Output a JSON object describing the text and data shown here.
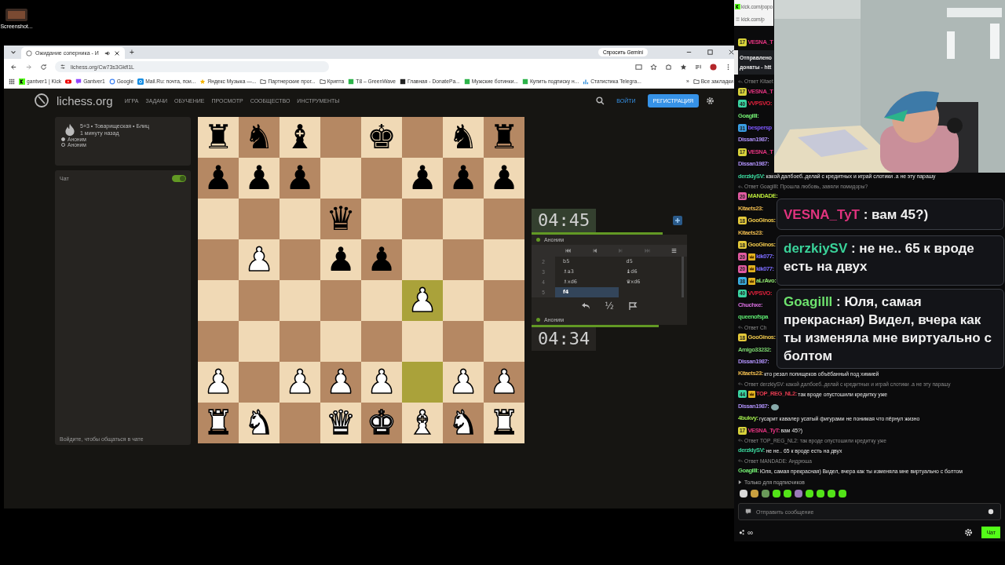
{
  "desktop": {
    "icon_label": "Screenshot..."
  },
  "browser": {
    "tab": {
      "title": "Ожидание соперника - И",
      "audio": true
    },
    "new_tab": "+",
    "gemini_button": "Спросить Gemini",
    "address": "lichess.org/Cw73s3Gkfl1L",
    "bookmarks": [
      {
        "kind": "kick",
        "label": "gantver1 | Kick"
      },
      {
        "kind": "youtube"
      },
      {
        "kind": "twitch",
        "label": "Gantver1"
      },
      {
        "kind": "google",
        "label": "Google"
      },
      {
        "kind": "mail",
        "label": "Mail.Ru: почта, пои..."
      },
      {
        "kind": "star",
        "label": "Яндекс Музыка —..."
      },
      {
        "kind": "folder",
        "label": "Партнерские прог..."
      },
      {
        "kind": "folder",
        "label": "Крипта"
      },
      {
        "kind": "green",
        "label": "T8 – GreenWave"
      },
      {
        "kind": "dark",
        "label": "Главная - DonatePa..."
      },
      {
        "kind": "green",
        "label": "Мужские ботинки..."
      },
      {
        "kind": "green",
        "label": "Купить подписку н..."
      },
      {
        "kind": "chart",
        "label": "Статистика Telegra..."
      }
    ],
    "more_bookmarks": "»",
    "all_bookmarks": "Все закладки"
  },
  "lichess": {
    "logo": "lichess.org",
    "nav": [
      "ИГРА",
      "ЗАДАЧИ",
      "ОБУЧЕНИЕ",
      "ПРОСМОТР",
      "СООБЩЕСТВО",
      "ИНСТРУМЕНТЫ"
    ],
    "login": "ВОЙТИ",
    "signup": "РЕГИСТРАЦИЯ"
  },
  "game": {
    "title": "5+3 • Товарищеская • Блиц",
    "time": "1 минуту назад",
    "players": [
      {
        "name": "Аноним",
        "white": true
      },
      {
        "name": "Аноним",
        "white": false
      }
    ]
  },
  "chat_panel": {
    "title": "Чат",
    "on": true,
    "footer": "Войдите, чтобы общаться в чате"
  },
  "board": {
    "ranks": [
      [
        {
          "piece": "♜",
          "white": false,
          "highlighted": false
        },
        {
          "piece": "♞",
          "white": false,
          "highlighted": false
        },
        {
          "piece": "♝",
          "white": false,
          "highlighted": false
        },
        {
          "highlighted": false
        },
        {
          "piece": "♚",
          "white": false,
          "highlighted": false
        },
        {
          "highlighted": false
        },
        {
          "piece": "♞",
          "white": false,
          "highlighted": false
        },
        {
          "piece": "♜",
          "white": false,
          "highlighted": false
        }
      ],
      [
        {
          "piece": "♟",
          "white": false,
          "highlighted": false
        },
        {
          "piece": "♟",
          "white": false,
          "highlighted": false
        },
        {
          "piece": "♟",
          "white": false,
          "highlighted": false
        },
        {
          "highlighted": false
        },
        {
          "highlighted": false
        },
        {
          "piece": "♟",
          "white": false,
          "highlighted": false
        },
        {
          "piece": "♟",
          "white": false,
          "highlighted": false
        },
        {
          "piece": "♟",
          "white": false,
          "highlighted": false
        }
      ],
      [
        {
          "highlighted": false
        },
        {
          "highlighted": false
        },
        {
          "highlighted": false
        },
        {
          "piece": "♛",
          "white": false,
          "highlighted": false
        },
        {
          "highlighted": false
        },
        {
          "highlighted": false
        },
        {
          "highlighted": false
        },
        {
          "highlighted": false
        }
      ],
      [
        {
          "highlighted": false
        },
        {
          "piece": "♟",
          "white": true,
          "highlighted": false
        },
        {
          "highlighted": false
        },
        {
          "piece": "♟",
          "white": false,
          "highlighted": false
        },
        {
          "piece": "♟",
          "white": false,
          "highlighted": false
        },
        {
          "highlighted": false
        },
        {
          "highlighted": false
        },
        {
          "highlighted": false
        }
      ],
      [
        {
          "highlighted": false
        },
        {
          "highlighted": false
        },
        {
          "highlighted": false
        },
        {
          "highlighted": false
        },
        {
          "highlighted": false
        },
        {
          "piece": "♟",
          "white": true,
          "highlighted": true
        },
        {
          "highlighted": false
        },
        {
          "highlighted": false
        }
      ],
      [
        {
          "highlighted": false
        },
        {
          "highlighted": false
        },
        {
          "highlighted": false
        },
        {
          "highlighted": false
        },
        {
          "highlighted": false
        },
        {
          "highlighted": false
        },
        {
          "highlighted": false
        },
        {
          "highlighted": false
        }
      ],
      [
        {
          "piece": "♟",
          "white": true,
          "highlighted": false
        },
        {
          "highlighted": false
        },
        {
          "piece": "♟",
          "white": true,
          "highlighted": false
        },
        {
          "piece": "♟",
          "white": true,
          "highlighted": false
        },
        {
          "piece": "♟",
          "white": true,
          "highlighted": false
        },
        {
          "highlighted": true
        },
        {
          "piece": "♟",
          "white": true,
          "highlighted": false
        },
        {
          "piece": "♟",
          "white": true,
          "highlighted": false
        }
      ],
      [
        {
          "piece": "♜",
          "white": true,
          "highlighted": false
        },
        {
          "piece": "♞",
          "white": true,
          "highlighted": false
        },
        {
          "highlighted": false
        },
        {
          "piece": "♛",
          "white": true,
          "highlighted": false
        },
        {
          "piece": "♚",
          "white": true,
          "highlighted": false
        },
        {
          "piece": "♝",
          "white": true,
          "highlighted": false
        },
        {
          "piece": "♞",
          "white": true,
          "highlighted": false
        },
        {
          "piece": "♜",
          "white": true,
          "highlighted": false
        }
      ]
    ]
  },
  "clocks": {
    "top": {
      "time": "04:45",
      "player": "Аноним",
      "online": true,
      "level": 0.93
    },
    "bottom": {
      "time": "04:34",
      "player": "Аноним",
      "online": true,
      "level": 0.9
    }
  },
  "moves": [
    {
      "number": "2",
      "white": {
        "san": "b5",
        "selected": false
      },
      "black": {
        "san": "d5",
        "selected": false
      }
    },
    {
      "number": "3",
      "white": {
        "san": "♗a3",
        "selected": false
      },
      "black": {
        "san": "♝d6",
        "selected": false
      }
    },
    {
      "number": "4",
      "white": {
        "san": "♗xd6",
        "selected": false
      },
      "black": {
        "san": "♛xd6",
        "selected": false
      }
    },
    {
      "number": "5",
      "white": {
        "san": "f4",
        "selected": true
      }
    }
  ],
  "draw_offer": "½",
  "stream": {
    "kick_tabs": [
      "kick.com/popo",
      "kick.com/p"
    ],
    "messages": [
      {
        "kind": "message",
        "badge": {
          "text": "17",
          "color": "#d8d23a"
        },
        "user": "VESNA_T",
        "color": "#e0337e"
      },
      {
        "kind": "pinned",
        "lines": [
          "Отправлено",
          "донаты - htt"
        ]
      },
      {
        "kind": "reply",
        "text": "Ответ Kitaet"
      },
      {
        "kind": "message",
        "badge": {
          "text": "17",
          "color": "#d8d23a"
        },
        "user": "VESNA_T",
        "color": "#e0337e"
      },
      {
        "kind": "message",
        "badge": {
          "text": "40",
          "color": "#3ad3a0"
        },
        "user": "VVPSVO:",
        "color": "#e0213c"
      },
      {
        "kind": "message",
        "user": "Goagilll:",
        "color": "#6ee36e"
      },
      {
        "kind": "message",
        "badge": {
          "text": "31",
          "color": "#3a9ee3"
        },
        "user": "bespersp",
        "color": "#7a55f5"
      },
      {
        "kind": "message",
        "user": "Dissan1987:",
        "color": "#a98cf0"
      },
      {
        "kind": "message",
        "badge": {
          "text": "17",
          "color": "#d8d23a"
        },
        "user": "VESNA_T",
        "color": "#e0337e"
      },
      {
        "kind": "message",
        "user": "Dissan1987:",
        "color": "#a98cf0"
      },
      {
        "kind": "message",
        "user": "derzkiySV:",
        "color": "#3ad39a",
        "text": "какой далбоеб..делай с кредитных и играй слотики .а не эту парашу"
      },
      {
        "kind": "reply",
        "text": "Ответ Goagilll: Прошла любовь, завяли помидоры?"
      },
      {
        "kind": "message",
        "badge": {
          "text": "20",
          "color": "#e05aa0"
        },
        "user": "MANDADE:",
        "color": "#b6e33a"
      },
      {
        "kind": "message",
        "user": "Kitaets23:",
        "color": "#e8b64c"
      },
      {
        "kind": "message",
        "badge": {
          "text": "18",
          "color": "#e3c83a"
        },
        "user": "GooGinos:",
        "color": "#e8c24a"
      },
      {
        "kind": "message",
        "user": "Kitaets23:",
        "color": "#e8b64c"
      },
      {
        "kind": "message",
        "badge": {
          "text": "18",
          "color": "#e3c83a"
        },
        "user": "GooGinos:",
        "color": "#e8c24a"
      },
      {
        "kind": "message",
        "badge": {
          "text": "20",
          "color": "#e05aa0"
        },
        "crown": true,
        "user": "kik077:",
        "color": "#7c6cff"
      },
      {
        "kind": "message",
        "badge": {
          "text": "20",
          "color": "#e05aa0"
        },
        "crown": true,
        "user": "kik077:",
        "color": "#7c6cff"
      },
      {
        "kind": "message",
        "badge": {
          "text": "38",
          "color": "#3ab0e3"
        },
        "crown": true,
        "user": "aLrAvo:",
        "color": "#8ee36e"
      },
      {
        "kind": "message",
        "badge": {
          "text": "40",
          "color": "#3ad3a0"
        },
        "user": "VVPSVO:",
        "color": "#e0213c"
      },
      {
        "kind": "message",
        "user": "Chuchxe:",
        "color": "#d86fe0"
      },
      {
        "kind": "message",
        "user": "queenofspa",
        "color": "#5be36e"
      },
      {
        "kind": "reply",
        "text": "Ответ Ch"
      },
      {
        "kind": "message",
        "badge": {
          "text": "18",
          "color": "#e3c83a"
        },
        "user": "GooGinos:",
        "color": "#e8c24a"
      },
      {
        "kind": "message",
        "user": "Amigo33232:",
        "color": "#7ad36e"
      },
      {
        "kind": "message",
        "user": "Dissan1987:",
        "color": "#a98cf0"
      },
      {
        "kind": "message",
        "user": "Kitaets23:",
        "color": "#e8b64c",
        "text": "кто резал попищеков объёбанный под химией"
      },
      {
        "kind": "reply",
        "text": "Ответ derzkiySV: какой далбоеб..делай с кредитных и играй слотики .а не эту парашу"
      },
      {
        "kind": "message",
        "badge": {
          "text": "44",
          "color": "#3ad3a0"
        },
        "crown": true,
        "user": "TOP_REG_NL2:",
        "color": "#e03a4e",
        "text": "так вроде опустошили кредитку уже"
      },
      {
        "kind": "message",
        "user": "Dissan1987:",
        "color": "#a98cf0",
        "emote": true
      },
      {
        "kind": "message",
        "user": "4bukvy:",
        "color": "#9be34a",
        "text": "гусарит кавалер усатый фигурами не понимая что пёрнул жизно"
      },
      {
        "kind": "message",
        "badge": {
          "text": "17",
          "color": "#d8d23a"
        },
        "user": "VESNA_TyT:",
        "color": "#e0337e",
        "text": "вам 45?)"
      },
      {
        "kind": "reply",
        "text": "Ответ TOP_REG_NL2: так вроде опустошили кредитку уже"
      },
      {
        "kind": "message",
        "user": "derzkiySV:",
        "color": "#3ad39a",
        "text": "не не.. 65 к вроде есть на двух"
      },
      {
        "kind": "reply",
        "text": "Ответ MANDADE: Андрюша"
      },
      {
        "kind": "message",
        "user": "Goagilll:",
        "color": "#6ee36e",
        "text": "Юля, самая прекрасная) Видел, вчера как ты изменяла мне виртуально с болтом"
      }
    ],
    "overlays": [
      {
        "user": "VESNA_TyT",
        "color": "#e0337e",
        "text": ": вам 45?)"
      },
      {
        "user": "derzkiySV",
        "color": "#3ad39a",
        "text": ": не не.. 65 к вроде есть на двух"
      },
      {
        "user": "Goagilll",
        "color": "#6ee36e",
        "text": ": Юля, самая прекрасная) Видел, вчера как ты изменяла мне виртуально с болтом"
      }
    ],
    "subscribers_only": "Только для подписчиков",
    "emotes": [
      {
        "color": "#d9d9d9"
      },
      {
        "color": "#c9a040"
      },
      {
        "color": "#6a9a5a"
      },
      {
        "color": "#53e318"
      },
      {
        "color": "#53e318"
      },
      {
        "color": "#9a7ab8"
      },
      {
        "color": "#53e318"
      },
      {
        "color": "#53e318"
      },
      {
        "color": "#53e318"
      },
      {
        "color": "#53e318"
      }
    ],
    "input_placeholder": "Отправить сообщение",
    "viewers": "∞",
    "send_button": "Чат"
  }
}
